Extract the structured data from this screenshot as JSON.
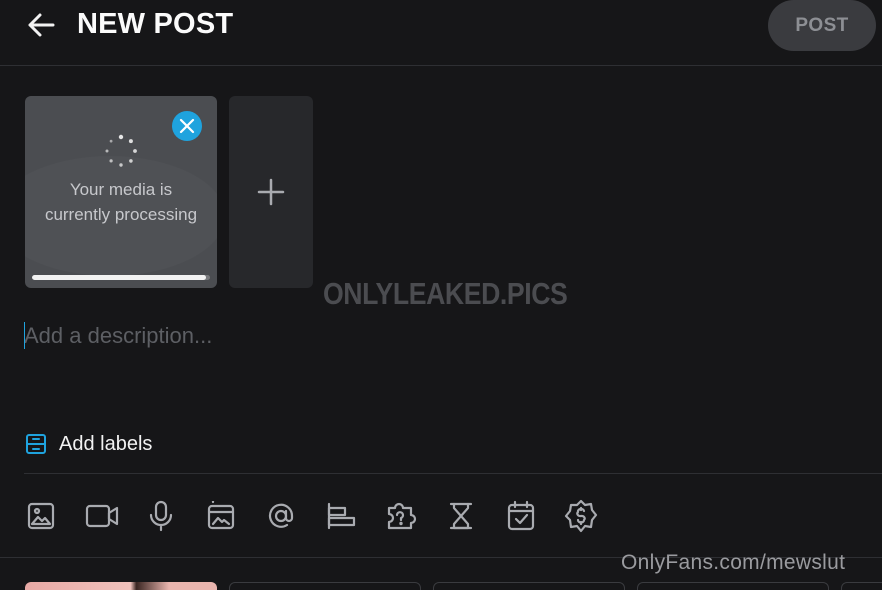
{
  "header": {
    "title": "NEW POST",
    "post_label": "POST"
  },
  "media": {
    "processing_text": "Your media is currently processing",
    "progress": 0.98
  },
  "watermark": "ONLYLEAKED.PICS",
  "description": {
    "placeholder": "Add a description...",
    "value": ""
  },
  "labels": {
    "label": "Add labels"
  },
  "toolbar": {
    "tools": [
      "image-icon",
      "video-icon",
      "microphone-icon",
      "vault-icon",
      "mention-icon",
      "text-align-icon",
      "quiz-icon",
      "expire-icon",
      "schedule-icon",
      "price-icon"
    ]
  },
  "footer_watermark": "OnlyFans.com/mewslut",
  "colors": {
    "accent": "#1fa3de",
    "background": "#161618",
    "card": "#4b4d51"
  }
}
